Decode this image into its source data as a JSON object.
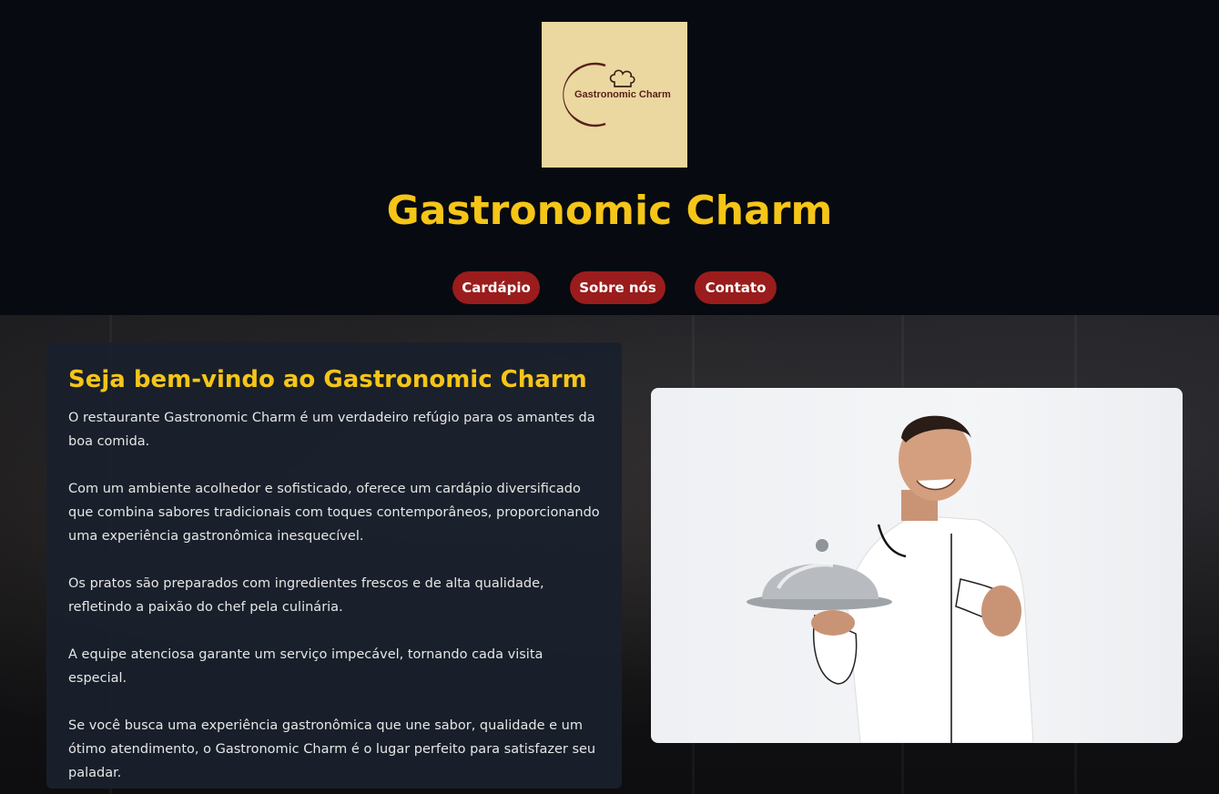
{
  "logo": {
    "text": "Gastronomic Charm",
    "icon": "chef-hat-icon"
  },
  "header": {
    "title": "Gastronomic Charm"
  },
  "nav": {
    "items": [
      {
        "label": "Cardápio"
      },
      {
        "label": "Sobre nós"
      },
      {
        "label": "Contato"
      }
    ]
  },
  "welcome": {
    "title": "Seja bem-vindo ao Gastronomic Charm",
    "paragraphs": [
      "O restaurante Gastronomic Charm é um verdadeiro refúgio para os amantes da boa comida.",
      "Com um ambiente acolhedor e sofisticado, oferece um cardápio diversificado que combina sabores tradicionais com toques contemporâneos, proporcionando uma experiência gastronômica inesquecível.",
      "Os pratos são preparados com ingredientes frescos e de alta qualidade, refletindo a paixão do chef pela culinária.",
      "A equipe atenciosa garante um serviço impecável, tornando cada visita especial.",
      "Se você busca uma experiência gastronômica que une sabor, qualidade e um ótimo atendimento, o Gastronomic Charm é o lugar perfeito para satisfazer seu paladar."
    ]
  },
  "colors": {
    "background": "#070a10",
    "title_yellow": "#f5c518",
    "nav_red": "#9b1c1c",
    "logo_bg": "#ead8a0",
    "card_bg": "#19202c"
  }
}
